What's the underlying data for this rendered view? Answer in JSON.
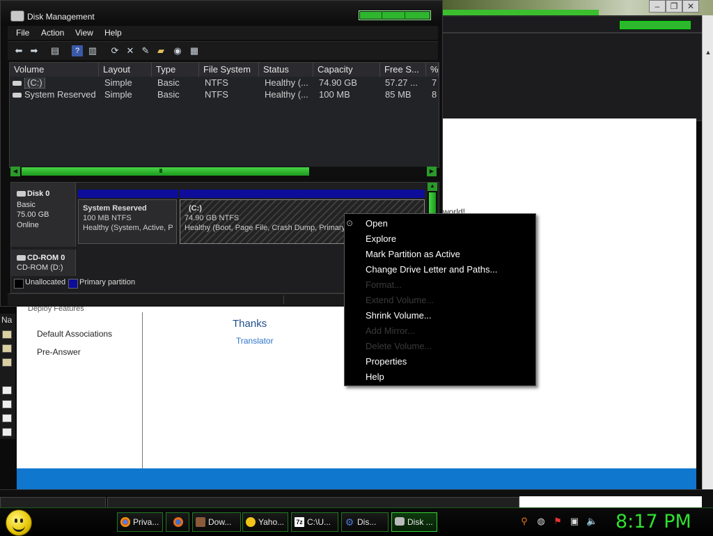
{
  "disk_mgmt": {
    "title": "Disk Management",
    "menu": [
      "File",
      "Action",
      "View",
      "Help"
    ],
    "toolbar_icons": [
      "back-icon",
      "forward-icon",
      "console-tree-icon",
      "help-icon",
      "show-pane-icon",
      "rescan-icon",
      "delete-icon",
      "properties-icon",
      "open-icon",
      "explore-icon",
      "settings-icon"
    ],
    "columns": [
      "Volume",
      "Layout",
      "Type",
      "File System",
      "Status",
      "Capacity",
      "Free S...",
      "%"
    ],
    "rows": [
      {
        "volume": "(C:)",
        "layout": "Simple",
        "type": "Basic",
        "fs": "NTFS",
        "status": "Healthy (...",
        "capacity": "74.90 GB",
        "free": "57.27 ...",
        "pct": "7"
      },
      {
        "volume": "System Reserved",
        "layout": "Simple",
        "type": "Basic",
        "fs": "NTFS",
        "status": "Healthy (...",
        "capacity": "100 MB",
        "free": "85 MB",
        "pct": "8"
      }
    ],
    "disk0": {
      "name": "Disk 0",
      "kind": "Basic",
      "size": "75.00 GB",
      "state": "Online",
      "partitions": [
        {
          "title": "System Reserved",
          "line1": "100 MB NTFS",
          "line2": "Healthy (System, Active, P"
        },
        {
          "title": "(C:)",
          "line1": "74.90 GB NTFS",
          "line2": "Healthy (Boot, Page File, Crash Dump, Primary Pa"
        }
      ]
    },
    "cdrom": {
      "name": "CD-ROM 0",
      "drive": "CD-ROM (D:)"
    },
    "legend": {
      "unallocated": "Unallocated",
      "primary": "Primary partition",
      "unallocated_color": "#000000",
      "primary_color": "#0d0d9a"
    }
  },
  "context_menu": {
    "items": [
      {
        "label": "Open",
        "enabled": true
      },
      {
        "label": "Explore",
        "enabled": true
      },
      {
        "label": "Mark Partition as Active",
        "enabled": true
      },
      {
        "label": "Change Drive Letter and Paths...",
        "enabled": true
      },
      {
        "label": "Format...",
        "enabled": false
      },
      {
        "label": "Extend Volume...",
        "enabled": false
      },
      {
        "label": "Shrink Volume...",
        "enabled": true
      },
      {
        "label": "Add Mirror...",
        "enabled": false
      },
      {
        "label": "Delete Volume...",
        "enabled": false
      },
      {
        "label": "Properties",
        "enabled": true
      },
      {
        "label": "Help",
        "enabled": true
      }
    ]
  },
  "background": {
    "sidebar_links": [
      "Default Associations",
      "Pre-Answer"
    ],
    "thanks": "Thanks",
    "translator": "Translator",
    "world_text": "world!",
    "left_stub_text": "Na"
  },
  "taskbar": {
    "buttons": [
      {
        "label": "Priva...",
        "icon": "chrome-icon",
        "color": "#d44"
      },
      {
        "label": "",
        "icon": "firefox-icon",
        "color": "#e66b1a"
      },
      {
        "label": "Dow...",
        "icon": "download-icon",
        "color": "#8a5a3a"
      },
      {
        "label": "Yaho...",
        "icon": "yahoo-smiley-icon",
        "color": "#f0c419"
      },
      {
        "label": "C:\\U...",
        "icon": "7zip-icon",
        "color": "#ddd"
      },
      {
        "label": "Dis...",
        "icon": "gear-icon",
        "color": "#4a7ad4"
      },
      {
        "label": "Disk ...",
        "icon": "disk-mgmt-icon",
        "color": "#bbb"
      }
    ],
    "clock": "8:17 PM",
    "accent": "#2fe02f"
  }
}
